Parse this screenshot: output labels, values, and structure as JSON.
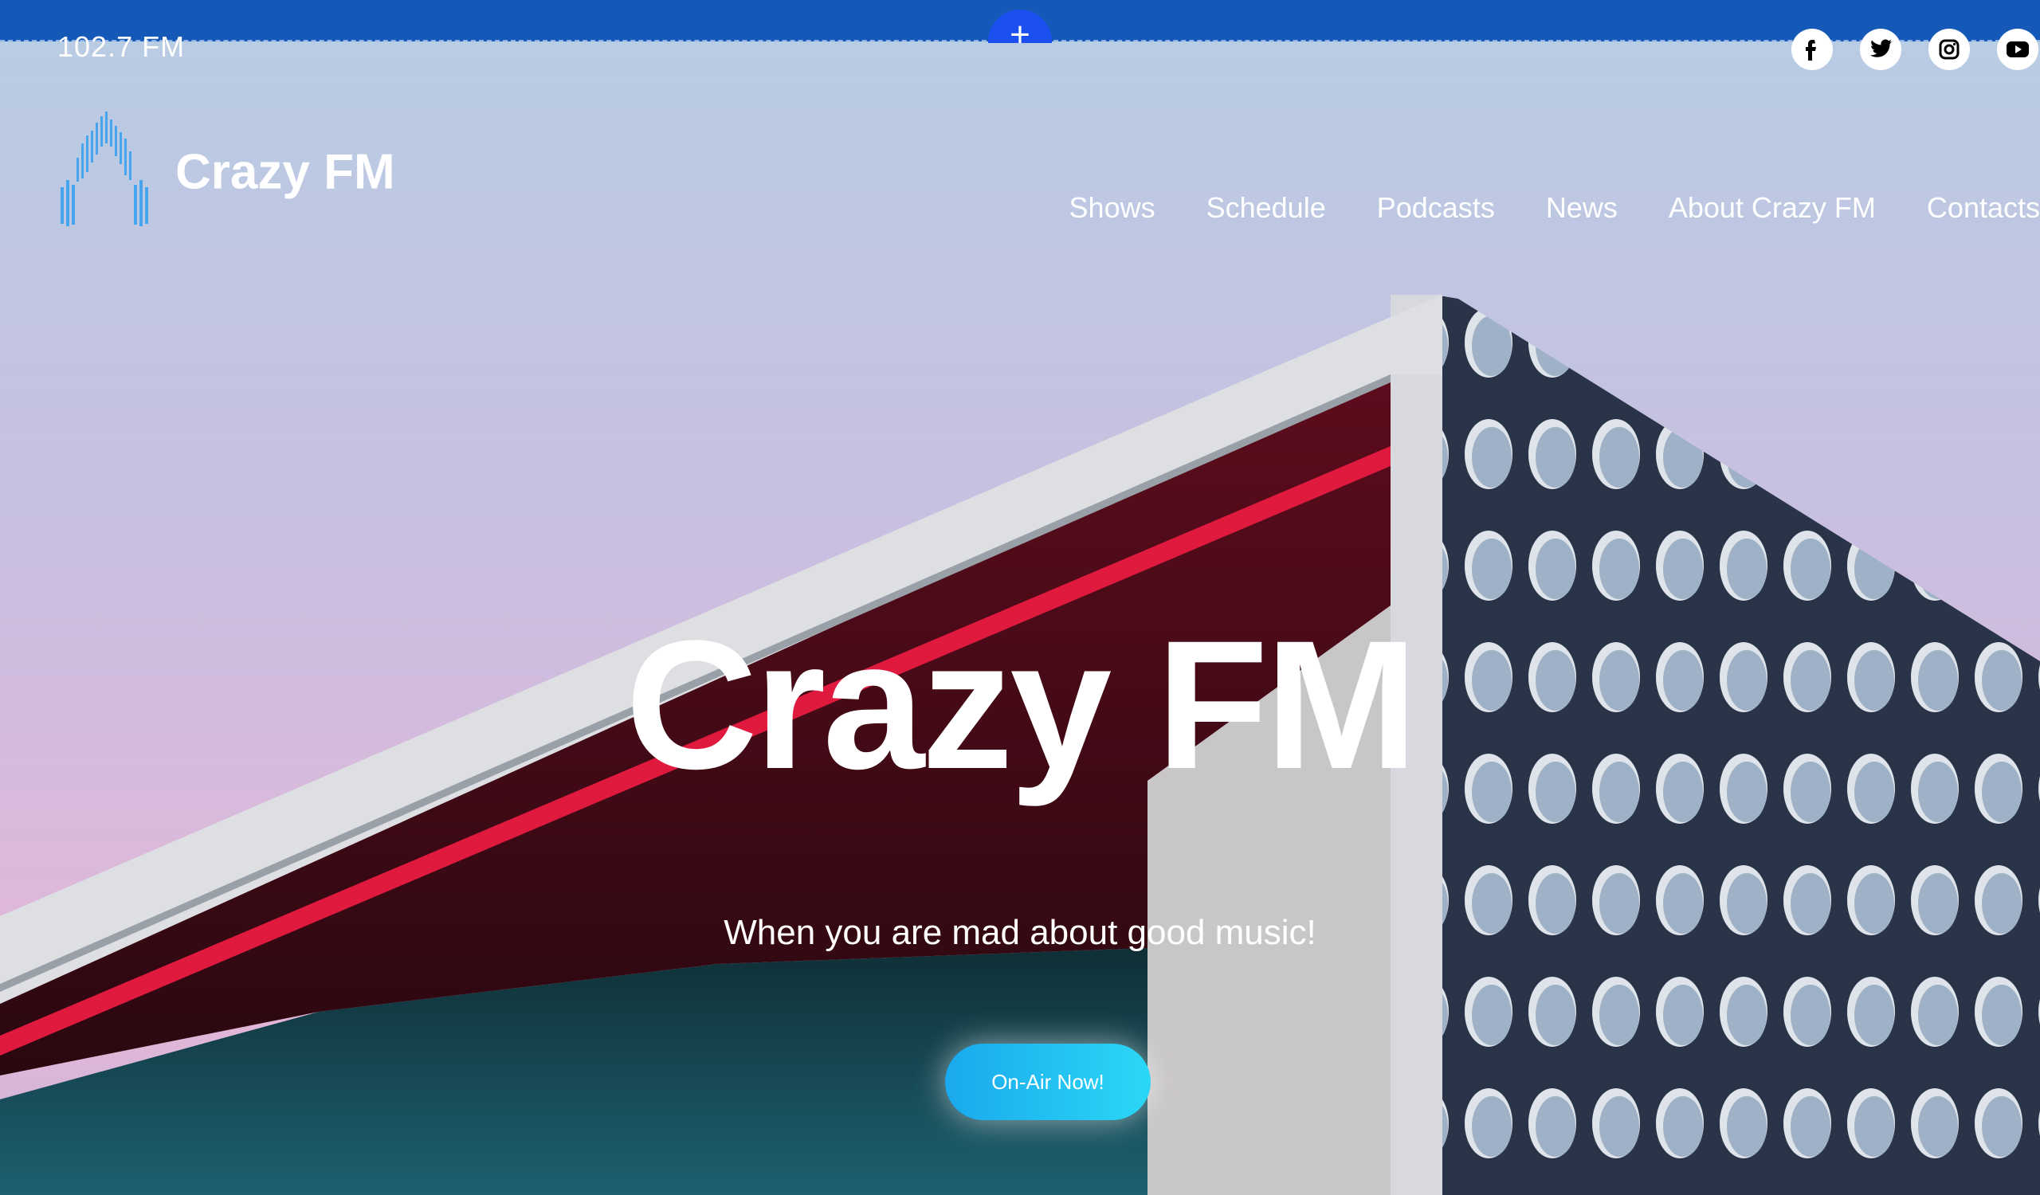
{
  "editor": {
    "add_section_label": "+"
  },
  "header": {
    "frequency": "102.7 FM",
    "brand": "Crazy FM",
    "social": [
      {
        "name": "facebook-icon",
        "glyph": "f"
      },
      {
        "name": "twitter-icon",
        "glyph": ""
      },
      {
        "name": "instagram-icon",
        "glyph": ""
      },
      {
        "name": "youtube-icon",
        "glyph": ""
      }
    ],
    "nav": [
      "Shows",
      "Schedule",
      "Podcasts",
      "News",
      "About Crazy FM",
      "Contacts"
    ]
  },
  "hero": {
    "title": "Crazy FM",
    "subtitle": "When you are mad about good music!",
    "cta": "On-Air Now!"
  },
  "colors": {
    "editor_bar": "#1458b8",
    "add_button": "#1c4ff0",
    "cta_start": "#1aa9ee",
    "cta_end": "#2bd7f5",
    "logo_blue": "#45a6ee"
  }
}
